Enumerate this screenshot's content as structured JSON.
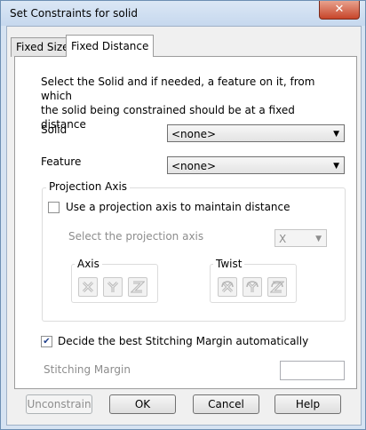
{
  "window": {
    "title": "Set Constraints for solid",
    "close_glyph": "✕"
  },
  "tabs": [
    {
      "label": "Fixed Size",
      "active": false
    },
    {
      "label": "Fixed Distance",
      "active": true
    }
  ],
  "panel": {
    "description": "Select the Solid and if needed, a feature on it, from which\nthe solid being constrained should be at a fixed distance",
    "solid": {
      "label": "Solid",
      "value": "<none>"
    },
    "feature": {
      "label": "Feature",
      "value": "<none>"
    },
    "projection": {
      "group_label": "Projection Axis",
      "checkbox_label": "Use a projection axis to maintain distance",
      "checked": false,
      "select_label": "Select the projection axis",
      "axis_value": "X",
      "axis_group": {
        "label": "Axis",
        "buttons": [
          "x-axis-icon",
          "y-axis-icon",
          "z-axis-icon"
        ]
      },
      "twist_group": {
        "label": "Twist",
        "buttons": [
          "x-twist-icon",
          "y-twist-icon",
          "z-twist-icon"
        ]
      }
    },
    "stitching": {
      "checkbox_label": "Decide the best Stitching Margin automatically",
      "checked": true,
      "check_glyph": "✔",
      "margin_label": "Stitching Margin",
      "margin_value": ""
    }
  },
  "buttons": {
    "unconstrain": "Unconstrain",
    "ok": "OK",
    "cancel": "Cancel",
    "help": "Help"
  },
  "colors": {
    "title_bar": "#c6d8ee",
    "close": "#c7452a",
    "disabled_text": "#8d8d8d"
  }
}
